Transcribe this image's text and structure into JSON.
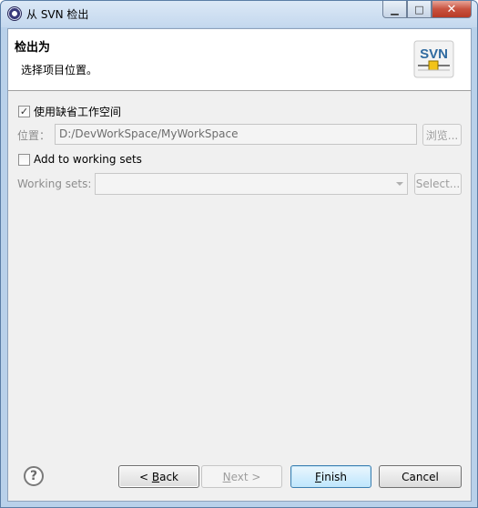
{
  "window": {
    "title": "从 SVN 检出",
    "minimize_glyph": "▁",
    "maximize_glyph": "□",
    "close_glyph": "✕"
  },
  "header": {
    "title": "检出为",
    "description": "选择项目位置。",
    "logo_text": "SVN"
  },
  "form": {
    "use_default_workspace": {
      "label": "使用缺省工作空间",
      "checked": true
    },
    "location_label": "位置：",
    "location_value": "D:/DevWorkSpace/MyWorkSpace",
    "browse_label": "浏览...",
    "add_to_working_sets": {
      "label": "Add to working sets",
      "checked": false
    },
    "working_sets_label": "Working sets:",
    "working_sets_value": "",
    "select_label": "Select..."
  },
  "footer": {
    "back_prefix": "< ",
    "back_mnemonic": "B",
    "back_rest": "ack",
    "next_mnemonic": "N",
    "next_rest": "ext >",
    "finish_mnemonic": "F",
    "finish_rest": "inish",
    "cancel_label": "Cancel"
  },
  "colors": {
    "accent_blue": "#3c7fb1",
    "disabled_text": "#8d8d8d",
    "svn_yellow": "#f2c318"
  },
  "icons": {
    "app": "svn-app-icon",
    "help": "help-icon",
    "logo": "svn-logo-icon"
  }
}
